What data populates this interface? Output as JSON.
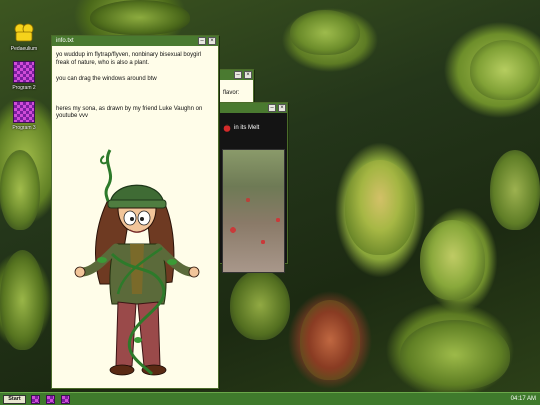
{
  "desktop_icons": [
    {
      "label": "Pedaeulium",
      "icon": "folder-icon"
    },
    {
      "label": "Program 2",
      "icon": "checker-icon"
    },
    {
      "label": "Program 3",
      "icon": "checker-icon"
    }
  ],
  "info_window": {
    "title": "info.txt",
    "paragraphs": [
      "yo wuddup im flytrap/flyven, nonbinary bisexual boygirl freak of nature, who is also a plant.",
      "you can drag the windows around btw",
      "heres my sona, as drawn by my friend Luke Vaughn on youtube vvv"
    ],
    "minimize": "–",
    "close": "×"
  },
  "flavor_window": {
    "title": "",
    "text": "flavor:",
    "minimize": "–",
    "close": "×"
  },
  "melt_window": {
    "title": "",
    "text": "in its Melt",
    "icon": "apple-icon",
    "minimize": "–",
    "close": "×"
  },
  "taskbar": {
    "start_label": "Start",
    "clock": "04:17 AM",
    "items": [
      "program-icon",
      "program-icon",
      "program-icon"
    ]
  },
  "colors": {
    "titlebar": "#4a7a30",
    "taskbar": "#3f7a2c",
    "window_bg": "#fffde9"
  }
}
